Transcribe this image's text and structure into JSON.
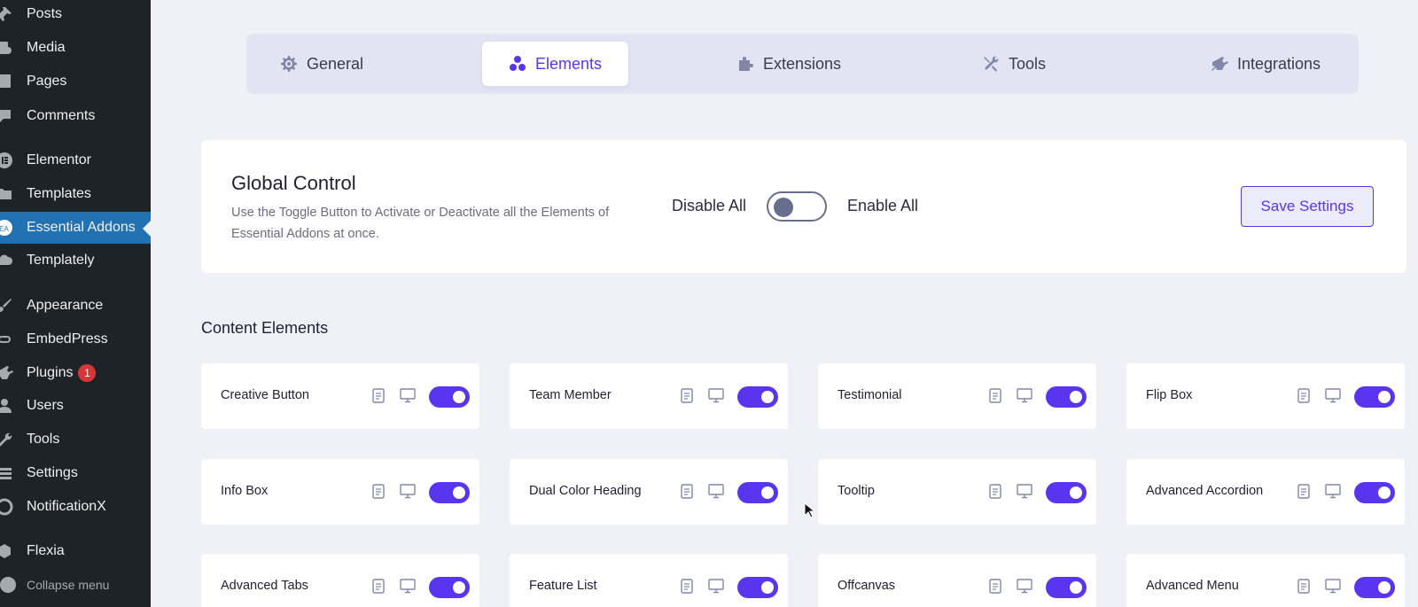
{
  "sidebar": {
    "items": [
      {
        "label": "Posts",
        "icon": "pin-icon"
      },
      {
        "label": "Media",
        "icon": "media-icon"
      },
      {
        "label": "Pages",
        "icon": "pages-icon"
      },
      {
        "label": "Comments",
        "icon": "comments-icon"
      },
      {
        "label": "Elementor",
        "icon": "elementor-icon"
      },
      {
        "label": "Templates",
        "icon": "folder-icon"
      },
      {
        "label": "Essential Addons",
        "icon": "ea-icon"
      },
      {
        "label": "Templately",
        "icon": "cloud-icon"
      },
      {
        "label": "Appearance",
        "icon": "brush-icon"
      },
      {
        "label": "EmbedPress",
        "icon": "link-icon"
      },
      {
        "label": "Plugins",
        "icon": "plug-icon",
        "badge": "1"
      },
      {
        "label": "Users",
        "icon": "user-icon"
      },
      {
        "label": "Tools",
        "icon": "wrench-icon"
      },
      {
        "label": "Settings",
        "icon": "settings-icon"
      },
      {
        "label": "NotificationX",
        "icon": "notification-icon"
      },
      {
        "label": "Flexia",
        "icon": "flexia-icon"
      },
      {
        "label": "Collapse menu",
        "icon": "collapse-icon"
      }
    ],
    "active": "Essential Addons"
  },
  "tabs": [
    {
      "label": "General",
      "icon": "gear-icon"
    },
    {
      "label": "Elements",
      "icon": "elements-icon",
      "active": true
    },
    {
      "label": "Extensions",
      "icon": "puzzle-icon"
    },
    {
      "label": "Tools",
      "icon": "tools-icon"
    },
    {
      "label": "Integrations",
      "icon": "plug-icon"
    }
  ],
  "global_control": {
    "title": "Global Control",
    "description": "Use the Toggle Button to Activate or Deactivate all the Elements of Essential Addons at once.",
    "disable_label": "Disable All",
    "enable_label": "Enable All",
    "toggle_state": "off",
    "save_label": "Save Settings"
  },
  "section": {
    "title": "Content Elements"
  },
  "elements": [
    {
      "name": "Creative Button",
      "enabled": true
    },
    {
      "name": "Team Member",
      "enabled": true
    },
    {
      "name": "Testimonial",
      "enabled": true
    },
    {
      "name": "Flip Box",
      "enabled": true
    },
    {
      "name": "Info Box",
      "enabled": true
    },
    {
      "name": "Dual Color Heading",
      "enabled": true
    },
    {
      "name": "Tooltip",
      "enabled": true
    },
    {
      "name": "Advanced Accordion",
      "enabled": true
    },
    {
      "name": "Advanced Tabs",
      "enabled": true
    },
    {
      "name": "Feature List",
      "enabled": true
    },
    {
      "name": "Offcanvas",
      "enabled": true
    },
    {
      "name": "Advanced Menu",
      "enabled": true
    }
  ],
  "colors": {
    "accent": "#5a35f0",
    "sidebar_bg": "#1d2327",
    "sidebar_active": "#2271b1",
    "badge": "#d63638"
  }
}
